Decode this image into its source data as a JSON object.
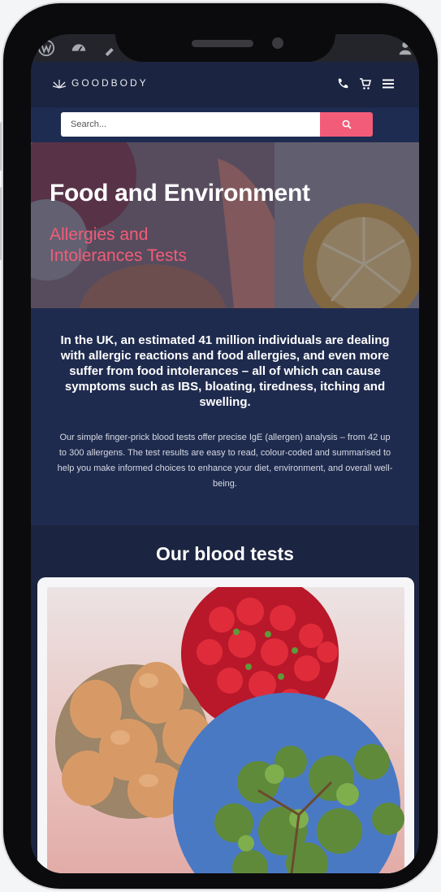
{
  "header": {
    "logo_text": "GOODBODY"
  },
  "search": {
    "placeholder": "Search..."
  },
  "hero": {
    "title": "Food and Environment",
    "subtitle": "Allergies and Intolerances Tests"
  },
  "intro": {
    "lead": "In the UK, an estimated 41 million individuals are dealing with allergic reactions and food allergies, and even more suffer from food intolerances – all of which can cause symptoms such as IBS, bloating, tiredness, itching and swelling.",
    "body": "Our simple finger-prick blood tests offer precise IgE (allergen) analysis – from 42 up to 300 allergens. The test results are easy to read, colour-coded and summarised to help you make informed choices to enhance your diet, environment, and overall well-being."
  },
  "tests": {
    "title": "Our blood tests"
  },
  "icons": {
    "admin": [
      "wordpress-icon",
      "dashboard-icon",
      "customize-icon",
      "user-icon"
    ],
    "header": [
      "phone-icon",
      "cart-icon",
      "menu-icon"
    ],
    "search": "search-icon"
  },
  "colors": {
    "navy": "#1b2440",
    "accent_pink": "#f25c78",
    "search_bar": "#1e2c52"
  }
}
